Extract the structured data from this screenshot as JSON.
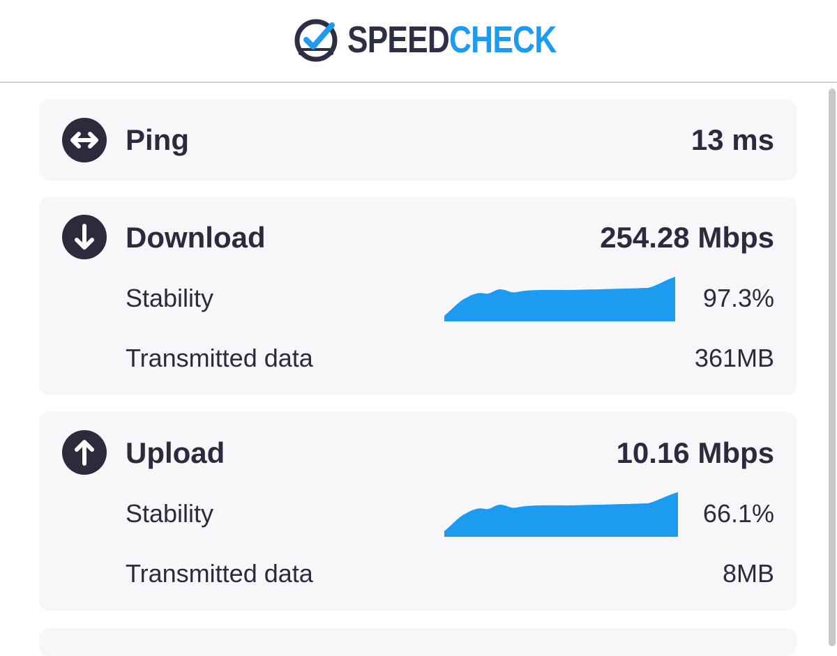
{
  "header": {
    "logo_speed": "SPEED",
    "logo_check": "CHECK",
    "logo_icon": "speedometer-check-icon"
  },
  "ping": {
    "icon": "double-arrow-icon",
    "label": "Ping",
    "value": "13 ms"
  },
  "download": {
    "icon": "arrow-down-icon",
    "label": "Download",
    "value": "254.28 Mbps",
    "stability_label": "Stability",
    "stability_value": "97.3%",
    "transmitted_label": "Transmitted data",
    "transmitted_value": "361MB"
  },
  "upload": {
    "icon": "arrow-up-icon",
    "label": "Upload",
    "value": "10.16 Mbps",
    "stability_label": "Stability",
    "stability_value": "66.1%",
    "transmitted_label": "Transmitted data",
    "transmitted_value": "8MB"
  },
  "colors": {
    "accent": "#1d9bf0",
    "dark": "#2b2b3d",
    "card_bg": "#f7f7f9"
  }
}
